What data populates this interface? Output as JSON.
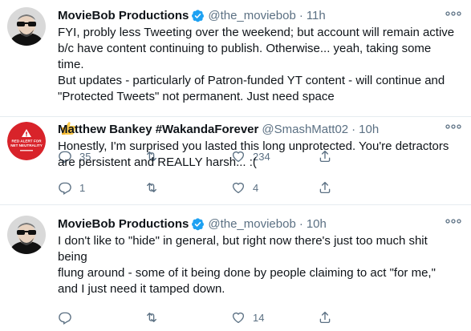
{
  "tweets": [
    {
      "name": "MovieBob Productions",
      "handle": "@the_moviebob",
      "separator": "·",
      "time": "11h",
      "verified": true,
      "text": "FYI, probly less Tweeting over the weekend; but account will remain active\nb/c have content continuing to publish. Otherwise... yeah, taking some time.\nBut updates - particularly of Patron-funded YT content - will continue and\n\"Protected Tweets\" not permanent. Just need space",
      "emoji": "thumbs-up",
      "replies": "35",
      "retweets": "",
      "likes": "234"
    },
    {
      "name": "Matthew Bankey #WakandaForever",
      "handle": "@SmashMatt02",
      "separator": "·",
      "time": "10h",
      "verified": false,
      "avatar_text": "RED ALERT FOR NET NEUTRALITY",
      "text": "Honestly, I'm surprised you lasted this long unprotected.  You're detractors\nare persistent and REALLY harsh... :(",
      "replies": "1",
      "retweets": "",
      "likes": "4"
    },
    {
      "name": "MovieBob Productions",
      "handle": "@the_moviebob",
      "separator": "·",
      "time": "10h",
      "verified": true,
      "text": "I don't like to \"hide\" in general, but right now there's just too much shit being\nflung around - some of it being done by people claiming to act \"for me,\"\nand I just need it tamped down.",
      "replies": "",
      "retweets": "",
      "likes": "14"
    }
  ],
  "colors": {
    "accent": "#1da1f2",
    "muted": "#5b7083",
    "alert_red": "#d8232a"
  },
  "icons": [
    "verified-badge-icon",
    "more-icon",
    "reply-icon",
    "retweet-icon",
    "like-icon",
    "share-icon",
    "thumbs-up-emoji"
  ]
}
